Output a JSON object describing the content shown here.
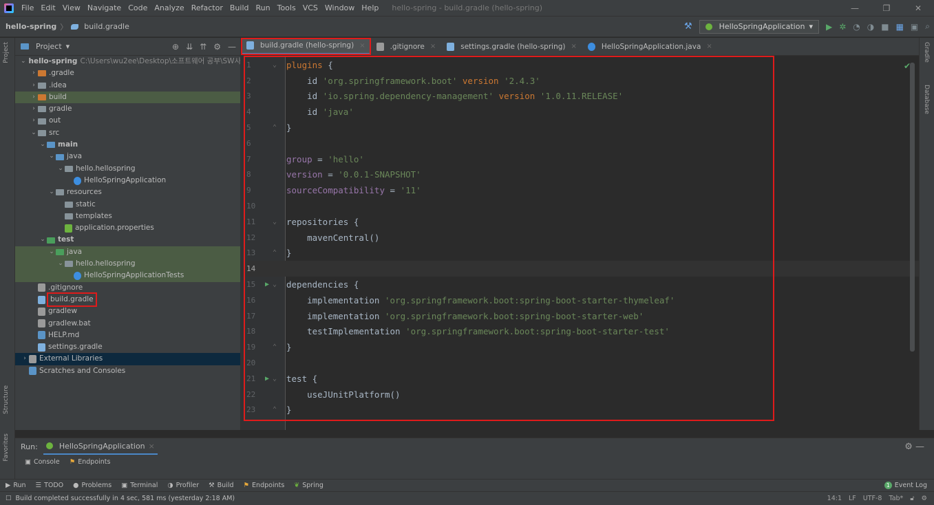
{
  "menu": {
    "items": [
      "File",
      "Edit",
      "View",
      "Navigate",
      "Code",
      "Analyze",
      "Refactor",
      "Build",
      "Run",
      "Tools",
      "VCS",
      "Window",
      "Help"
    ],
    "window_title": "hello-spring - build.gradle (hello-spring)"
  },
  "window_controls": {
    "minimize": "—",
    "restore": "❐",
    "close": "✕"
  },
  "navbar": {
    "project": "hello-spring",
    "file": "build.gradle",
    "run_config": "HelloSpringApplication"
  },
  "project_panel": {
    "title": "Project",
    "tree": [
      {
        "label": "hello-spring",
        "extra": "C:\\Users\\wu2ee\\Desktop\\소프트웨어 공부\\SW사",
        "depth": 0,
        "chev": "open",
        "icon": "folder-blue",
        "bold": true
      },
      {
        "label": ".gradle",
        "depth": 1,
        "chev": "closed",
        "icon": "folder-orange"
      },
      {
        "label": ".idea",
        "depth": 1,
        "chev": "closed",
        "icon": "folder"
      },
      {
        "label": "build",
        "depth": 1,
        "chev": "closed",
        "icon": "folder-orange",
        "hl": true
      },
      {
        "label": "gradle",
        "depth": 1,
        "chev": "closed",
        "icon": "folder"
      },
      {
        "label": "out",
        "depth": 1,
        "chev": "closed",
        "icon": "folder"
      },
      {
        "label": "src",
        "depth": 1,
        "chev": "open",
        "icon": "folder"
      },
      {
        "label": "main",
        "depth": 2,
        "chev": "open",
        "icon": "folder-blue",
        "bold": true
      },
      {
        "label": "java",
        "depth": 3,
        "chev": "open",
        "icon": "folder-blue"
      },
      {
        "label": "hello.hellospring",
        "depth": 4,
        "chev": "open",
        "icon": "folder"
      },
      {
        "label": "HelloSpringApplication",
        "depth": 5,
        "chev": "none",
        "icon": "spring"
      },
      {
        "label": "resources",
        "depth": 3,
        "chev": "open",
        "icon": "folder"
      },
      {
        "label": "static",
        "depth": 4,
        "chev": "none",
        "icon": "folder"
      },
      {
        "label": "templates",
        "depth": 4,
        "chev": "none",
        "icon": "folder"
      },
      {
        "label": "application.properties",
        "depth": 4,
        "chev": "none",
        "icon": "props"
      },
      {
        "label": "test",
        "depth": 2,
        "chev": "open",
        "icon": "folder-green",
        "bold": true
      },
      {
        "label": "java",
        "depth": 3,
        "chev": "open",
        "icon": "folder-green",
        "hl": true
      },
      {
        "label": "hello.hellospring",
        "depth": 4,
        "chev": "open",
        "icon": "folder",
        "hl": true
      },
      {
        "label": "HelloSpringApplicationTests",
        "depth": 5,
        "chev": "none",
        "icon": "spring",
        "hl": true
      },
      {
        "label": ".gitignore",
        "depth": 1,
        "chev": "none",
        "icon": "git"
      },
      {
        "label": "build.gradle",
        "depth": 1,
        "chev": "none",
        "icon": "gradle",
        "boxed": true
      },
      {
        "label": "gradlew",
        "depth": 1,
        "chev": "none",
        "icon": "exec"
      },
      {
        "label": "gradlew.bat",
        "depth": 1,
        "chev": "none",
        "icon": "bat"
      },
      {
        "label": "HELP.md",
        "depth": 1,
        "chev": "none",
        "icon": "md"
      },
      {
        "label": "settings.gradle",
        "depth": 1,
        "chev": "none",
        "icon": "gradle"
      },
      {
        "label": "External Libraries",
        "depth": 0,
        "chev": "closed",
        "icon": "lib",
        "sel": true
      },
      {
        "label": "Scratches and Consoles",
        "depth": 0,
        "chev": "none",
        "icon": "scratch"
      }
    ]
  },
  "tabs": [
    {
      "label": "build.gradle (hello-spring)",
      "icon": "gradle",
      "active": true
    },
    {
      "label": ".gitignore",
      "icon": "git"
    },
    {
      "label": "settings.gradle (hello-spring)",
      "icon": "gradle"
    },
    {
      "label": "HelloSpringApplication.java",
      "icon": "spring"
    }
  ],
  "editor": {
    "current_line": 14,
    "lines": [
      {
        "n": "1",
        "fold": "open",
        "tokens": [
          [
            "kw",
            "plugins"
          ],
          [
            "plain",
            " {"
          ]
        ]
      },
      {
        "n": "2",
        "tokens": [
          [
            "plain",
            "    id "
          ],
          [
            "str",
            "'org.springframework.boot'"
          ],
          [
            "plain",
            " "
          ],
          [
            "kw",
            "version"
          ],
          [
            "plain",
            " "
          ],
          [
            "str",
            "'2.4.3'"
          ]
        ]
      },
      {
        "n": "3",
        "tokens": [
          [
            "plain",
            "    id "
          ],
          [
            "str",
            "'io.spring.dependency-management'"
          ],
          [
            "plain",
            " "
          ],
          [
            "kw",
            "version"
          ],
          [
            "plain",
            " "
          ],
          [
            "str",
            "'1.0.11.RELEASE'"
          ]
        ]
      },
      {
        "n": "4",
        "tokens": [
          [
            "plain",
            "    id "
          ],
          [
            "str",
            "'java'"
          ]
        ]
      },
      {
        "n": "5",
        "fold": "close",
        "tokens": [
          [
            "plain",
            "}"
          ]
        ]
      },
      {
        "n": "6",
        "tokens": []
      },
      {
        "n": "7",
        "tokens": [
          [
            "var",
            "group"
          ],
          [
            "plain",
            " = "
          ],
          [
            "str",
            "'hello'"
          ]
        ]
      },
      {
        "n": "8",
        "tokens": [
          [
            "var",
            "version"
          ],
          [
            "plain",
            " = "
          ],
          [
            "str",
            "'0.0.1-SNAPSHOT'"
          ]
        ]
      },
      {
        "n": "9",
        "tokens": [
          [
            "var",
            "sourceCompatibility"
          ],
          [
            "plain",
            " = "
          ],
          [
            "str",
            "'11'"
          ]
        ]
      },
      {
        "n": "10",
        "tokens": []
      },
      {
        "n": "11",
        "fold": "open",
        "tokens": [
          [
            "plain",
            "repositories {"
          ]
        ]
      },
      {
        "n": "12",
        "tokens": [
          [
            "plain",
            "    mavenCentral()"
          ]
        ]
      },
      {
        "n": "13",
        "fold": "close",
        "tokens": [
          [
            "plain",
            "}"
          ]
        ]
      },
      {
        "n": "14",
        "tokens": []
      },
      {
        "n": "15",
        "run": true,
        "fold": "open",
        "tokens": [
          [
            "plain",
            "dependencies {"
          ]
        ]
      },
      {
        "n": "16",
        "tokens": [
          [
            "plain",
            "    implementation "
          ],
          [
            "str",
            "'org.springframework.boot:spring-boot-starter-thymeleaf'"
          ]
        ]
      },
      {
        "n": "17",
        "tokens": [
          [
            "plain",
            "    implementation "
          ],
          [
            "str",
            "'org.springframework.boot:spring-boot-starter-web'"
          ]
        ]
      },
      {
        "n": "18",
        "tokens": [
          [
            "plain",
            "    testImplementation "
          ],
          [
            "str",
            "'org.springframework.boot:spring-boot-starter-test'"
          ]
        ]
      },
      {
        "n": "19",
        "fold": "close",
        "tokens": [
          [
            "plain",
            "}"
          ]
        ]
      },
      {
        "n": "20",
        "tokens": []
      },
      {
        "n": "21",
        "run": true,
        "fold": "open",
        "tokens": [
          [
            "plain",
            "test {"
          ]
        ]
      },
      {
        "n": "22",
        "tokens": [
          [
            "plain",
            "    useJUnitPlatform()"
          ]
        ]
      },
      {
        "n": "23",
        "fold": "close",
        "tokens": [
          [
            "plain",
            "}"
          ]
        ]
      }
    ]
  },
  "side_labels": {
    "project": "Project",
    "structure": "Structure",
    "favorites": "Favorites",
    "gradle": "Gradle",
    "database": "Database"
  },
  "run_panel": {
    "label": "Run:",
    "config": "HelloSpringApplication",
    "console": "Console",
    "endpoints": "Endpoints"
  },
  "tool_windows": [
    "Run",
    "TODO",
    "Problems",
    "Terminal",
    "Profiler",
    "Build",
    "Endpoints",
    "Spring"
  ],
  "event_log": {
    "count": "1",
    "label": "Event Log"
  },
  "status": {
    "message": "Build completed successfully in 4 sec, 581 ms (yesterday 2:18 AM)",
    "position": "14:1",
    "line_sep": "LF",
    "encoding": "UTF-8",
    "indent": "Tab*"
  },
  "colors": {
    "accent": "#4a88c7",
    "highlight_box": "#e01b1b",
    "run_green": "#59a869"
  }
}
